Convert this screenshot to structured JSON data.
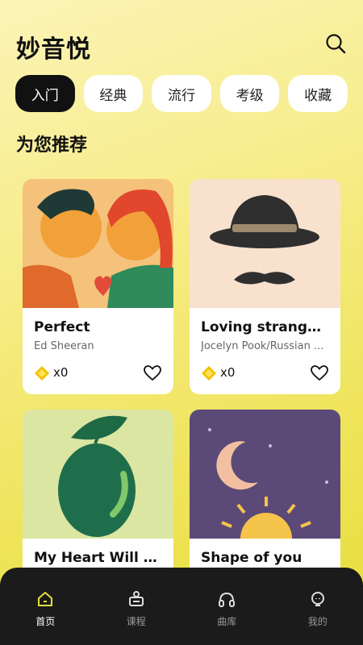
{
  "app": {
    "logo_text": "妙音悦"
  },
  "tabs": [
    {
      "label": "入门",
      "active": true
    },
    {
      "label": "经典",
      "active": false
    },
    {
      "label": "流行",
      "active": false
    },
    {
      "label": "考级",
      "active": false
    },
    {
      "label": "收藏",
      "active": false
    }
  ],
  "section": {
    "title": "为您推荐"
  },
  "songs": [
    {
      "title": "Perfect",
      "artist": "Ed Sheeran",
      "count": "x0"
    },
    {
      "title": "Loving strangers",
      "artist": "Jocelyn Pook/Russian ...",
      "count": "x0"
    },
    {
      "title": "My Heart Will Go...",
      "artist": "",
      "count": ""
    },
    {
      "title": "Shape of you",
      "artist": "",
      "count": ""
    }
  ],
  "tabbar": [
    {
      "label": "首页",
      "icon": "home-icon",
      "active": true
    },
    {
      "label": "课程",
      "icon": "course-icon",
      "active": false
    },
    {
      "label": "曲库",
      "icon": "headphones-icon",
      "active": false
    },
    {
      "label": "我的",
      "icon": "profile-icon",
      "active": false
    }
  ],
  "colors": {
    "accent": "#e6de3a",
    "tabbar_bg": "#1b1b1b",
    "active_tab_bg": "#111111"
  }
}
